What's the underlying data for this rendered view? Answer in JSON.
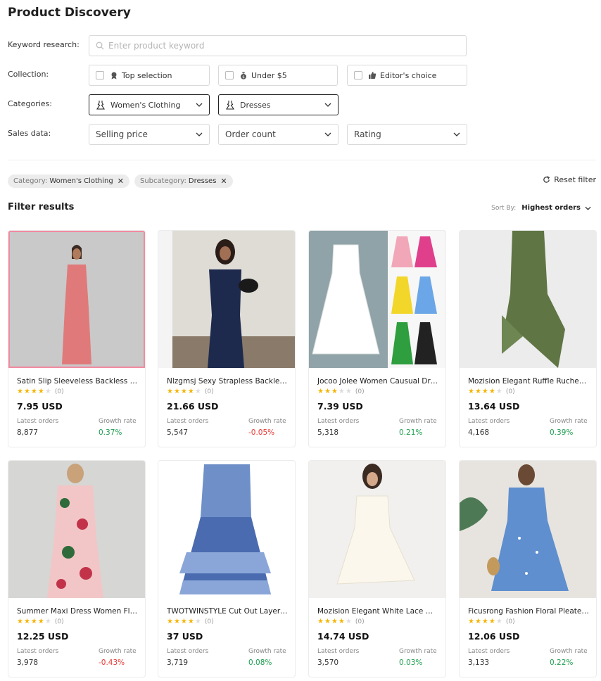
{
  "page": {
    "title": "Product Discovery"
  },
  "filters": {
    "keyword_label": "Keyword research:",
    "keyword_placeholder": "Enter product keyword",
    "keyword_value": "",
    "collection_label": "Collection:",
    "collections": [
      {
        "label": "Top selection",
        "icon": "medal-icon",
        "checked": false
      },
      {
        "label": "Under $5",
        "icon": "money-bag-icon",
        "checked": false
      },
      {
        "label": "Editor's choice",
        "icon": "thumbs-up-icon",
        "checked": false
      }
    ],
    "categories_label": "Categories:",
    "category": "Women's Clothing",
    "subcategory": "Dresses",
    "sales_label": "Sales data:",
    "sales": [
      "Selling price",
      "Order count",
      "Rating"
    ]
  },
  "active_filters": {
    "chips": [
      {
        "key": "Category:",
        "value": "Women's Clothing"
      },
      {
        "key": "Subcategory:",
        "value": "Dresses"
      }
    ],
    "reset_label": "Reset filter"
  },
  "results": {
    "title": "Filter results",
    "sort_label": "Sort By:",
    "sort_value": "Highest orders",
    "latest_label": "Latest orders",
    "growth_label": "Growth rate",
    "products": [
      {
        "name": "Satin Slip Sleeveless Backless Maxi Dress",
        "rating": 4,
        "reviews": "(0)",
        "price": "7.95 USD",
        "orders": "8,877",
        "growth": "0.37%",
        "trend": "up",
        "image": "pink-maxi-dress-photo"
      },
      {
        "name": "Nlzgmsj Sexy Strapless Backless Dress",
        "rating": 4,
        "reviews": "(0)",
        "price": "21.66 USD",
        "orders": "5,547",
        "growth": "-0.05%",
        "trend": "down",
        "image": "navy-strapless-dress-photo"
      },
      {
        "name": "Jocoo Jolee Women Causual Dress",
        "rating": 3,
        "reviews": "(0)",
        "price": "7.39 USD",
        "orders": "5,318",
        "growth": "0.21%",
        "trend": "up",
        "image": "white-tiered-dress-photo"
      },
      {
        "name": "Mozision Elegant Ruffle Ruched Dress",
        "rating": 4,
        "reviews": "(0)",
        "price": "13.64 USD",
        "orders": "4,168",
        "growth": "0.39%",
        "trend": "up",
        "image": "green-ruffle-dress-photo"
      },
      {
        "name": "Summer Maxi Dress Women Floral",
        "rating": 4,
        "reviews": "(0)",
        "price": "12.25 USD",
        "orders": "3,978",
        "growth": "-0.43%",
        "trend": "down",
        "image": "floral-maxi-dress-photo"
      },
      {
        "name": "TWOTWINSTYLE Cut Out Layered Dress",
        "rating": 4,
        "reviews": "(0)",
        "price": "37 USD",
        "orders": "3,719",
        "growth": "0.08%",
        "trend": "up",
        "image": "blue-print-dress-photo"
      },
      {
        "name": "Mozision Elegant White Lace Dress",
        "rating": 4,
        "reviews": "(0)",
        "price": "14.74 USD",
        "orders": "3,570",
        "growth": "0.03%",
        "trend": "up",
        "image": "white-lace-dress-photo"
      },
      {
        "name": "Ficusrong Fashion Floral Pleated Dress",
        "rating": 4,
        "reviews": "(0)",
        "price": "12.06 USD",
        "orders": "3,133",
        "growth": "0.22%",
        "trend": "up",
        "image": "blue-floral-dress-photo"
      }
    ]
  },
  "colors": {
    "positive": "#1e9e4f",
    "negative": "#e53935",
    "star": "#f5b400"
  }
}
